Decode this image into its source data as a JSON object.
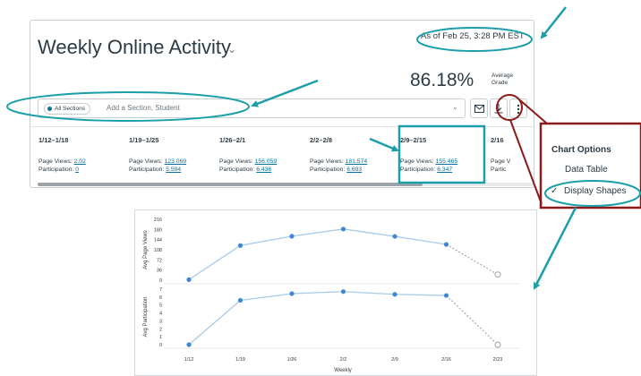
{
  "header": {
    "title": "Weekly Online Activity",
    "as_of": "As of Feb 25, 3:28 PM EST",
    "grade_value": "86.18%",
    "grade_label": "Average Grade"
  },
  "filter": {
    "chip_label": "All Sections",
    "placeholder": "Add a Section, Student"
  },
  "toolbar": {
    "mail_icon": "mail-icon",
    "download_icon": "download-icon",
    "more_icon": "kebab-icon"
  },
  "weeks": [
    {
      "range": "1/12–1/18",
      "views_label": "Page Views:",
      "views": "2.02",
      "part_label": "Participation:",
      "part": "0"
    },
    {
      "range": "1/19–1/25",
      "views_label": "Page Views:",
      "views": "123.069",
      "part_label": "Participation:",
      "part": "5.594"
    },
    {
      "range": "1/26–2/1",
      "views_label": "Page Views:",
      "views": "156.059",
      "part_label": "Participation:",
      "part": "6.436"
    },
    {
      "range": "2/2–2/8",
      "views_label": "Page Views:",
      "views": "181.574",
      "part_label": "Participation:",
      "part": "6.693"
    },
    {
      "range": "2/9–2/15",
      "views_label": "Page Views:",
      "views": "155.465",
      "part_label": "Participation:",
      "part": "6.347"
    },
    {
      "range": "2/16",
      "views_label": "Page V",
      "views": "",
      "part_label": "Partic",
      "part": ""
    }
  ],
  "menu": {
    "title": "Chart Options",
    "items": [
      "Data Table",
      "Display Shapes"
    ],
    "checked": "Display Shapes"
  },
  "colors": {
    "accent": "#1a9fa8",
    "dark_red": "#8b1a1a",
    "line": "#a9cbe8",
    "point": "#3f87d2",
    "link": "#0770a3"
  },
  "chart_data": [
    {
      "type": "line",
      "ylabel": "Avg Page Views",
      "yticks": [
        0,
        36,
        72,
        108,
        144,
        180,
        216
      ],
      "ylim": [
        0,
        216
      ],
      "x": [
        "1/12",
        "1/19",
        "1/26",
        "2/2",
        "2/9",
        "2/16",
        "2/23"
      ],
      "values": [
        2.02,
        123.069,
        156.059,
        181.574,
        155.465,
        127,
        20
      ],
      "last_point_projected": true
    },
    {
      "type": "line",
      "ylabel": "Avg Participation",
      "yticks": [
        0,
        1,
        2,
        3,
        4,
        5,
        6,
        7
      ],
      "ylim": [
        0,
        7
      ],
      "x": [
        "1/12",
        "1/19",
        "1/26",
        "2/2",
        "2/9",
        "2/16",
        "2/23"
      ],
      "values": [
        0,
        5.594,
        6.436,
        6.693,
        6.347,
        6.2,
        0
      ],
      "last_point_projected": true,
      "xlabel": "Weekly"
    }
  ]
}
